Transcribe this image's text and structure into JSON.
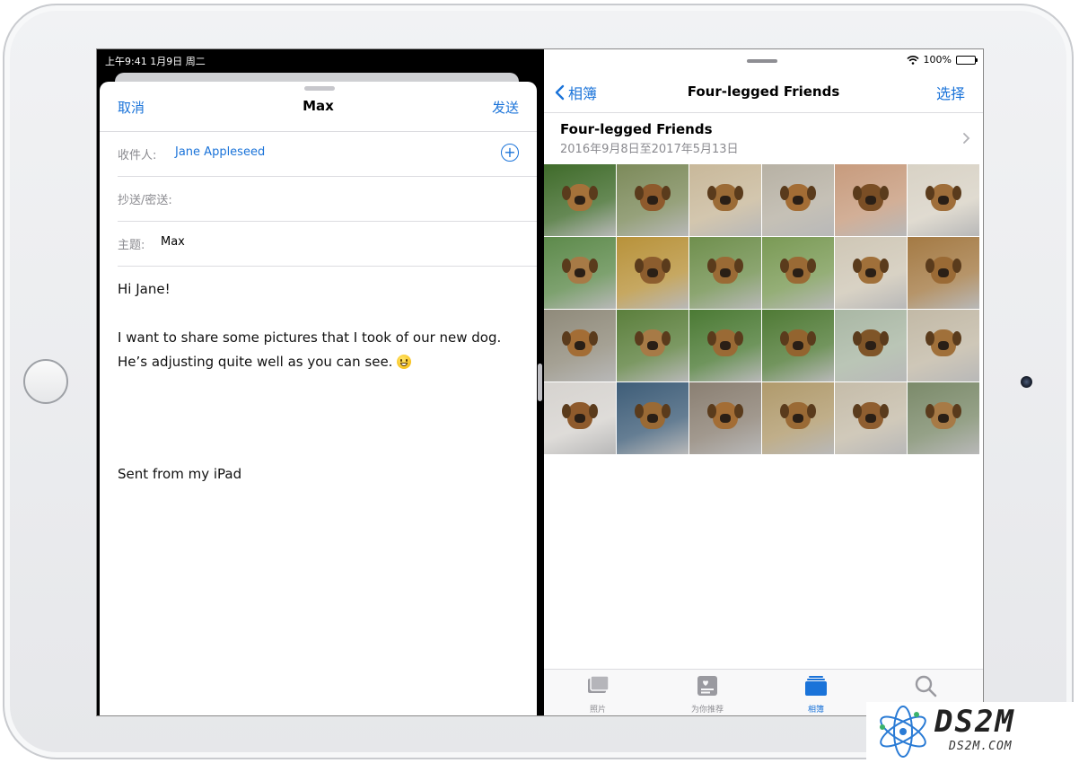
{
  "status_left": "上午9:41   1月9日 周二",
  "status_right": {
    "battery": "100%"
  },
  "mail": {
    "cancel": "取消",
    "title": "Max",
    "send": "发送",
    "to_label": "收件人:",
    "to_value": "Jane Appleseed",
    "cc_label": "抄送/密送:",
    "subject_label": "主题:",
    "subject_value": "Max",
    "greeting": "Hi Jane!",
    "line1": "I want to share some pictures that I took of our new dog.",
    "line2": "He’s adjusting quite well as you can see.",
    "signature": "Sent from my iPad"
  },
  "photos": {
    "back_label": "相簿",
    "title": "Four-legged Friends",
    "select_label": "选择",
    "album_title": "Four-legged Friends",
    "album_date": "2016年9月8日至2017年5月13日",
    "thumbnails": [
      {
        "bg": "#3f6b2a",
        "dog": "#a5723a"
      },
      {
        "bg": "#7c8a5a",
        "dog": "#8e5a2c"
      },
      {
        "bg": "#c8b89a",
        "dog": "#9b6b36"
      },
      {
        "bg": "#b7b1a4",
        "dog": "#a36d35"
      },
      {
        "bg": "#c79b7d",
        "dog": "#7a4e25"
      },
      {
        "bg": "#d8d2c5",
        "dog": "#9f6e3a"
      },
      {
        "bg": "#5d8a4b",
        "dog": "#a77a46"
      },
      {
        "bg": "#b8923a",
        "dog": "#8c5d2e"
      },
      {
        "bg": "#6f8f4d",
        "dog": "#9a6a35"
      },
      {
        "bg": "#7a9a55",
        "dog": "#9a6a35"
      },
      {
        "bg": "#cfc7b6",
        "dog": "#a0703a"
      },
      {
        "bg": "#a47a44",
        "dog": "#9a6a35"
      },
      {
        "bg": "#8f8a7a",
        "dog": "#a36d35"
      },
      {
        "bg": "#5b7f3c",
        "dog": "#a77a46"
      },
      {
        "bg": "#4b7a34",
        "dog": "#9a6a35"
      },
      {
        "bg": "#4f7a35",
        "dog": "#93642f"
      },
      {
        "bg": "#a9b7a4",
        "dog": "#7f5528"
      },
      {
        "bg": "#c2b9a6",
        "dog": "#a0703a"
      },
      {
        "bg": "#d6d3cf",
        "dog": "#8e5a2c"
      },
      {
        "bg": "#3e5d78",
        "dog": "#9a6a35"
      },
      {
        "bg": "#8a7f72",
        "dog": "#a36d35"
      },
      {
        "bg": "#b09a6c",
        "dog": "#9a6a35"
      },
      {
        "bg": "#c5bca9",
        "dog": "#8f5e30"
      },
      {
        "bg": "#7b8a6a",
        "dog": "#a77a46"
      }
    ],
    "tabs": [
      {
        "label": "照片",
        "icon": "photos-icon"
      },
      {
        "label": "为你推荐",
        "icon": "for-you-icon"
      },
      {
        "label": "相簿",
        "icon": "albums-icon"
      }
    ]
  },
  "watermark": {
    "big": "DS2M",
    "small": "DS2M.COM"
  },
  "colors": {
    "accent": "#1a73d9",
    "separator": "#dcdce0"
  }
}
